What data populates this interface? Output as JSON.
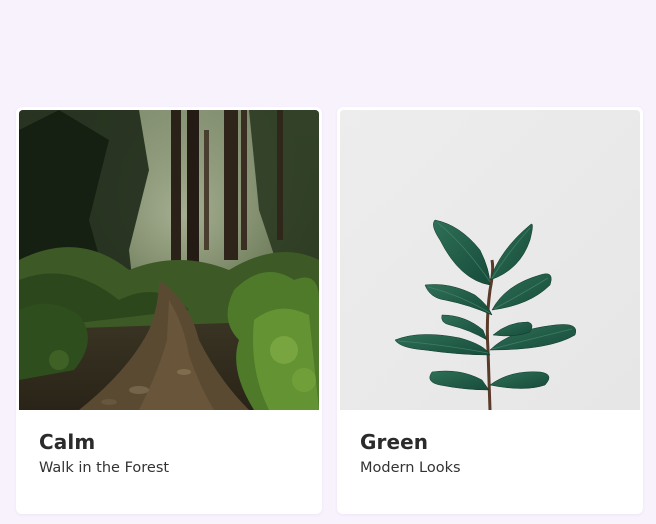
{
  "cards": [
    {
      "title": "Calm",
      "subtitle": "Walk in the Forest",
      "image": "forest-path-photo"
    },
    {
      "title": "Green",
      "subtitle": "Modern Looks",
      "image": "potted-plant-photo"
    }
  ],
  "colors": {
    "page_background": "#f8f2fd",
    "card_background": "#ffffff",
    "title_text": "#2b2b2b"
  }
}
